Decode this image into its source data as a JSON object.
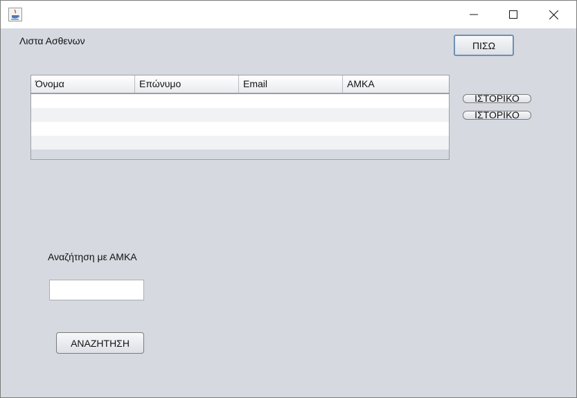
{
  "window": {
    "title": "",
    "controls": [
      "minimize-icon",
      "maximize-icon",
      "close-icon"
    ]
  },
  "labels": {
    "list_title": "Λιστα Ασθενων",
    "search_label": "Αναζήτηση με ΑΜΚΑ"
  },
  "buttons": {
    "back": "ΠΙΣΩ",
    "history_1": "ΙΣΤΟΡΙΚΟ",
    "history_2": "ΙΣΤΟΡΙΚΟ",
    "search": "ΑΝΑΖΗΤΗΣΗ"
  },
  "table": {
    "columns": [
      "Όνομα",
      "Επώνυμο",
      "Email",
      "ΑΜΚΑ"
    ],
    "rows": [
      [
        "",
        "",
        "",
        ""
      ],
      [
        "",
        "",
        "",
        ""
      ],
      [
        "",
        "",
        "",
        ""
      ],
      [
        "",
        "",
        "",
        ""
      ]
    ]
  },
  "search_input": {
    "value": "",
    "placeholder": ""
  }
}
